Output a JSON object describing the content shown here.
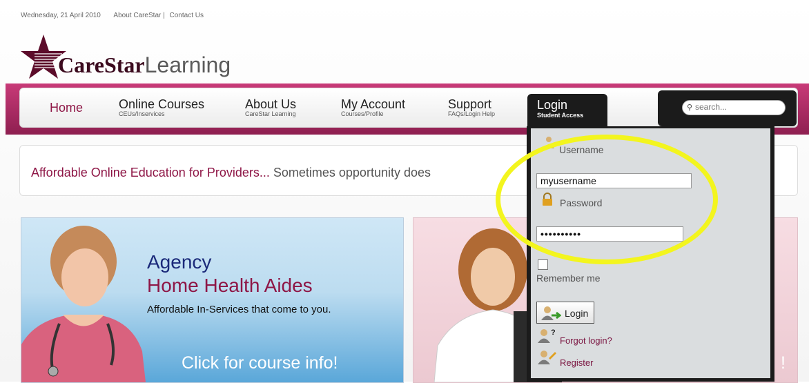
{
  "topbar": {
    "date": "Wednesday, 21 April 2010",
    "about_link": "About CareStar",
    "separator": "|",
    "contact_link": "Contact Us"
  },
  "logo": {
    "brand": "CareStar",
    "suffix": "Learning"
  },
  "nav": {
    "items": [
      {
        "label": "Home",
        "sub": ""
      },
      {
        "label": "Online Courses",
        "sub": "CEUs/Inservices"
      },
      {
        "label": "About Us",
        "sub": "CareStar Learning"
      },
      {
        "label": "My Account",
        "sub": "Courses/Profile"
      },
      {
        "label": "Support",
        "sub": "FAQs/Login Help"
      }
    ],
    "login_tab": {
      "label": "Login",
      "sub": "Student Access"
    }
  },
  "search": {
    "placeholder": "search..."
  },
  "banner": {
    "lead": "Affordable Online Education for Providers...",
    "rest": "Sometimes opportunity does"
  },
  "card_agency": {
    "line1": "Agency",
    "line2": "Home Health Aides",
    "line3": "Affordable In-Services that come to you.",
    "cta": "Click for course info!"
  },
  "card_second": {
    "cta_tail": "!"
  },
  "login_panel": {
    "username_label": "Username",
    "username_value": "myusername",
    "password_label": "Password",
    "password_value": "••••••••••",
    "remember_label": "Remember me",
    "remember_checked": false,
    "login_button": "Login",
    "forgot_link": "Forgot login?",
    "register_link": "Register"
  },
  "colors": {
    "brand": "#8e1646",
    "nav_band": "#b0306a",
    "dark": "#1b1b1b",
    "highlight": "#f3f51e"
  }
}
